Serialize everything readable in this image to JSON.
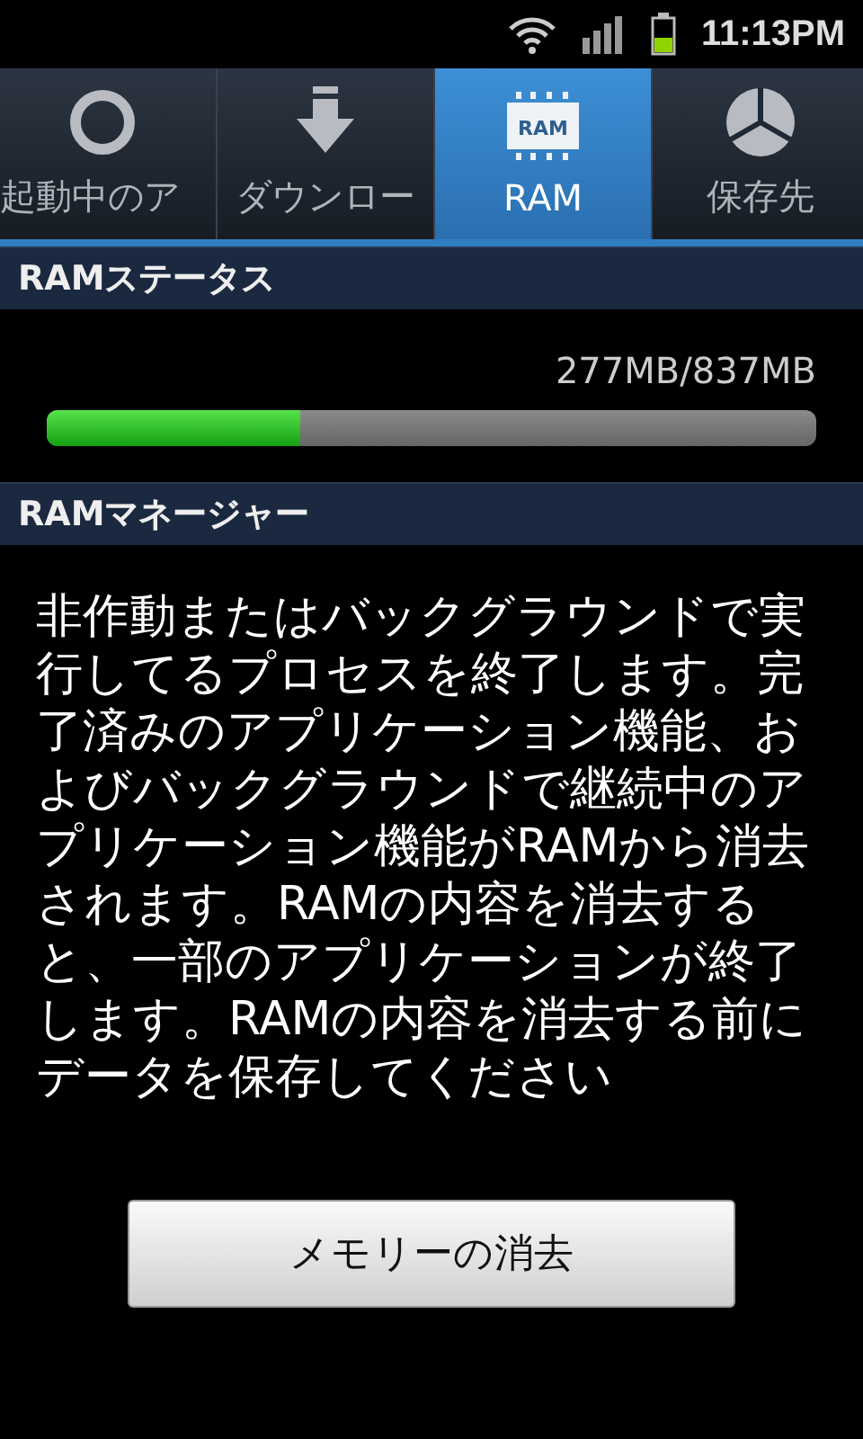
{
  "status_bar": {
    "time": "11:13PM"
  },
  "tabs": [
    {
      "label": "起動中のア",
      "kind": "ring",
      "selected": false
    },
    {
      "label": "ダウンロー",
      "kind": "download",
      "selected": false
    },
    {
      "label": "RAM",
      "kind": "ram",
      "icon_text": "RAM",
      "selected": true
    },
    {
      "label": "保存先",
      "kind": "pie",
      "selected": false
    }
  ],
  "ram_status": {
    "header": "RAMステータス",
    "reading": "277MB/837MB",
    "level": 0.33
  },
  "ram_manager": {
    "header": "RAMマネージャー",
    "description": "非作動またはバックグラウンドで実行してるプロセスを終了します。完了済みのアプリケーション機能、およびバックグラウンドで継続中のアプリケーション機能がRAMから消去されます。RAMの内容を消去すると、一部のアプリケーションが終了します。RAMの内容を消去する前にデータを保存してください",
    "button": "メモリーの消去"
  }
}
